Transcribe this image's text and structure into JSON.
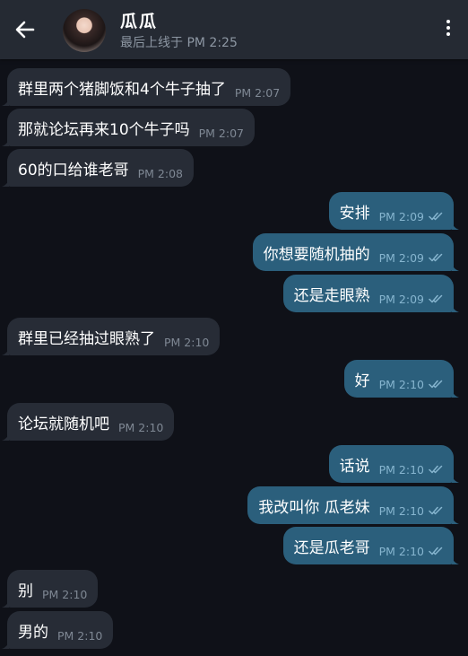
{
  "header": {
    "contact_name": "瓜瓜",
    "last_seen": "最后上线于 PM 2:25",
    "back_icon": "arrow-left-icon",
    "menu_icon": "more-vertical-icon"
  },
  "colors": {
    "background": "#0f1118",
    "header": "#252a33",
    "incoming_bubble": "#272c36",
    "outgoing_bubble": "#2b5f7c",
    "read_check": "#86b5cf"
  },
  "messages": [
    {
      "dir": "in",
      "text": "群里两个猪脚饭和4个牛子抽了",
      "time": "PM 2:07"
    },
    {
      "dir": "in",
      "text": "那就论坛再来10个牛子吗",
      "time": "PM 2:07"
    },
    {
      "dir": "in",
      "text": "60的口给谁老哥",
      "time": "PM 2:08"
    },
    {
      "dir": "out",
      "text": "安排",
      "time": "PM 2:09",
      "status": "read"
    },
    {
      "dir": "out",
      "text": "你想要随机抽的",
      "time": "PM 2:09",
      "status": "read"
    },
    {
      "dir": "out",
      "text": "还是走眼熟",
      "time": "PM 2:09",
      "status": "read"
    },
    {
      "dir": "in",
      "text": "群里已经抽过眼熟了",
      "time": "PM 2:10"
    },
    {
      "dir": "out",
      "text": "好",
      "time": "PM 2:10",
      "status": "read"
    },
    {
      "dir": "in",
      "text": "论坛就随机吧",
      "time": "PM 2:10"
    },
    {
      "dir": "out",
      "text": "话说",
      "time": "PM 2:10",
      "status": "read"
    },
    {
      "dir": "out",
      "text": "我改叫你 瓜老妹",
      "time": "PM 2:10",
      "status": "read"
    },
    {
      "dir": "out",
      "text": "还是瓜老哥",
      "time": "PM 2:10",
      "status": "read"
    },
    {
      "dir": "in",
      "text": "别",
      "time": "PM 2:10"
    },
    {
      "dir": "in",
      "text": "男的",
      "time": "PM 2:10"
    }
  ]
}
